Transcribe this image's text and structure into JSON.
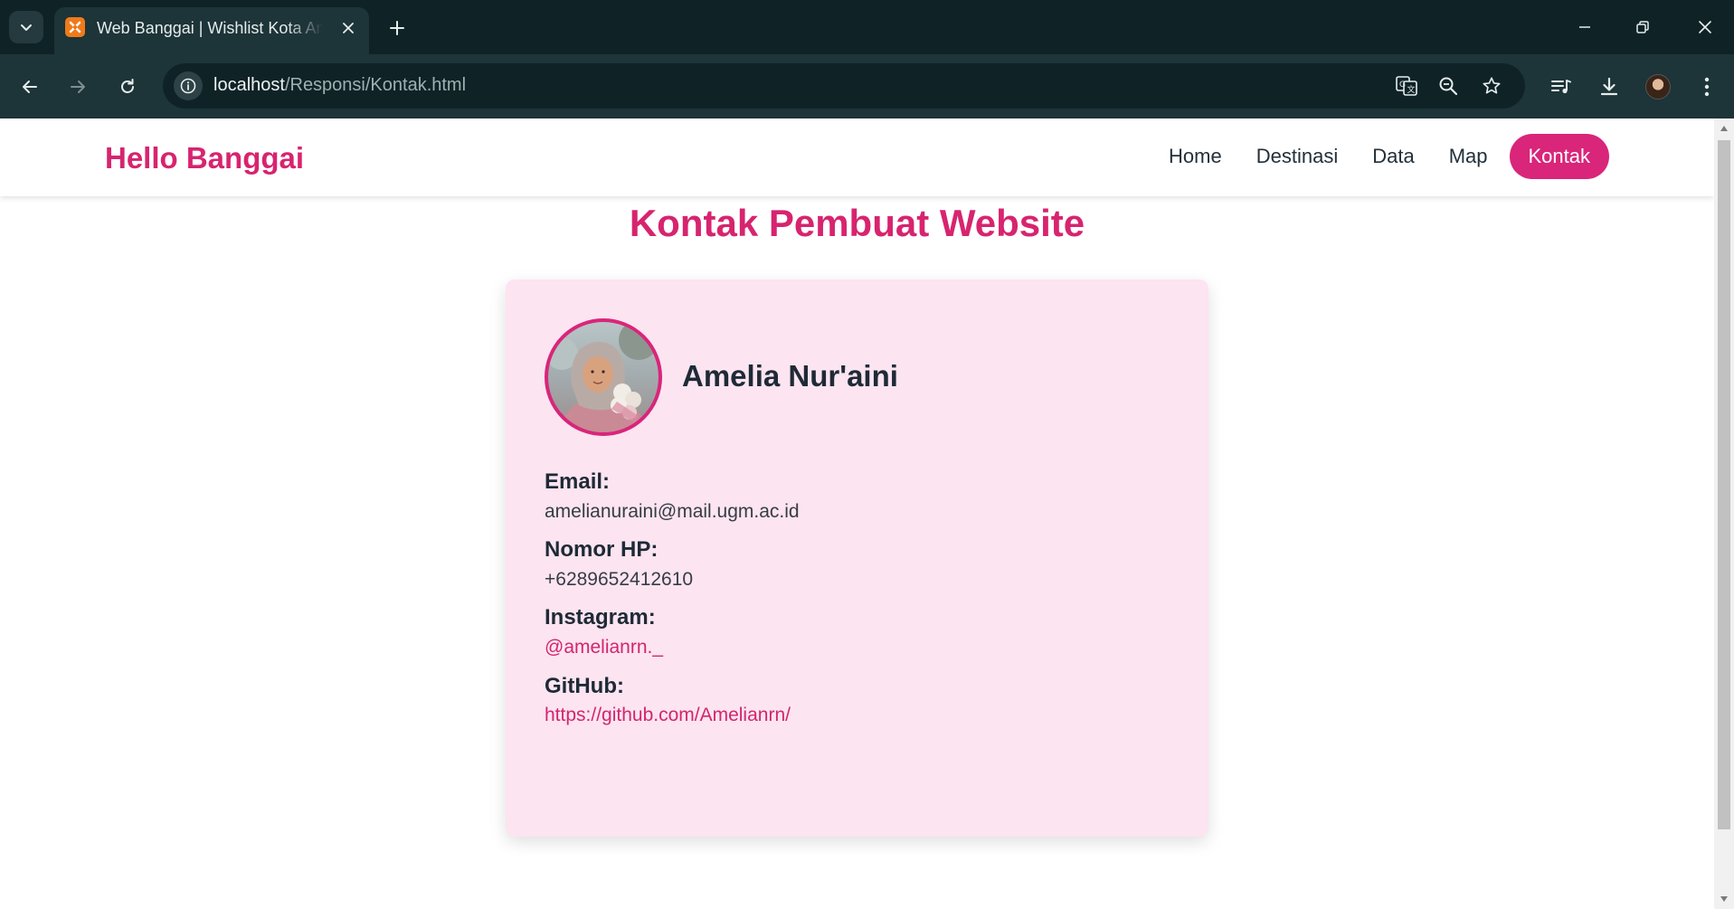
{
  "browser": {
    "tab_title": "Web Banggai | Wishlist Kota Amelia",
    "url_host": "localhost",
    "url_path": "/Responsi/Kontak.html"
  },
  "navbar": {
    "brand": "Hello Banggai",
    "links": [
      "Home",
      "Destinasi",
      "Data",
      "Map",
      "Kontak"
    ],
    "active": "Kontak"
  },
  "page": {
    "title": "Kontak Pembuat Website"
  },
  "profile": {
    "name": "Amelia Nur'aini",
    "email_label": "Email:",
    "email": "amelianuraini@mail.ugm.ac.id",
    "phone_label": "Nomor HP:",
    "phone": "+6289652412610",
    "instagram_label": "Instagram:",
    "instagram": "@amelianrn._",
    "github_label": "GitHub:",
    "github": "https://github.com/Amelianrn/"
  },
  "colors": {
    "accent": "#d9257a",
    "card_bg": "#fce4f1",
    "chrome_dark": "#0f2327",
    "chrome_toolbar": "#1d3438"
  },
  "icons": {
    "tab_search": "chevron-down-icon",
    "favicon": "xampp-icon",
    "tab_close": "close-icon",
    "new_tab": "plus-icon",
    "back": "arrow-left-icon",
    "forward": "arrow-right-icon",
    "reload": "reload-icon",
    "site_info": "info-icon",
    "translate": "translate-icon",
    "zoom": "zoom-out-icon",
    "bookmark": "star-icon",
    "media": "media-queue-icon",
    "downloads": "download-icon",
    "profile": "avatar",
    "menu": "kebab-menu-icon"
  }
}
